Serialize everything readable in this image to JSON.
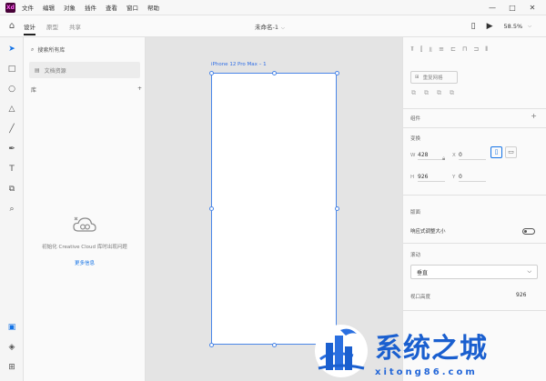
{
  "menubar": {
    "logo": "Xd",
    "items": [
      "文件",
      "编辑",
      "对象",
      "插件",
      "查看",
      "窗口",
      "帮助"
    ],
    "window_controls": [
      "—",
      "□",
      "✕"
    ]
  },
  "toolbar": {
    "tabs": [
      {
        "label": "设计",
        "active": true
      },
      {
        "label": "原型",
        "active": false
      },
      {
        "label": "共享",
        "active": false
      }
    ],
    "document_title": "未命名-1",
    "zoom": "58.5%"
  },
  "tools": [
    "select",
    "rectangle",
    "ellipse",
    "polygon",
    "line",
    "pen",
    "text",
    "artboard",
    "zoom"
  ],
  "assets": {
    "search_placeholder": "搜索所有库",
    "document_assets": "文档资源",
    "libraries_label": "库",
    "cc_message": "初始化 Creative Cloud 库时出现问题",
    "more_info": "更多信息"
  },
  "canvas": {
    "artboard_name": "iPhone 12 Pro Max – 1"
  },
  "properties": {
    "repeat_grid": "重复网格",
    "component_label": "组件",
    "transform_label": "变换",
    "width_label": "W",
    "width": "428",
    "height_label": "H",
    "height": "926",
    "x_label": "X",
    "x": "0",
    "y_label": "Y",
    "y": "0",
    "layout_label": "版面",
    "responsive_label": "响应式调整大小",
    "responsive_on": false,
    "scroll_label": "滚动",
    "scroll_value": "垂直",
    "viewport_label": "视口高度",
    "viewport_value": "926"
  },
  "watermark": {
    "title": "系统之城",
    "subtitle": "xitong86.com"
  },
  "colors": {
    "accent": "#1473e6",
    "artboard_border": "#4a86e8",
    "watermark_blue": "#1a5fcf"
  }
}
